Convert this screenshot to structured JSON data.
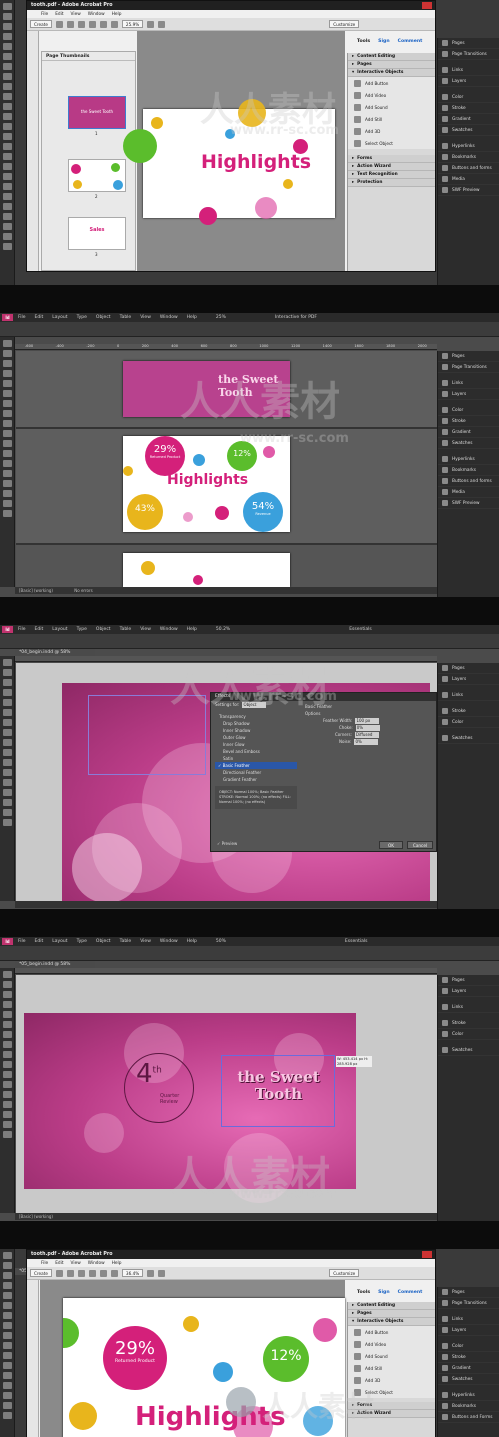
{
  "watermark": {
    "cn": "人人素材",
    "url": "www.rr-sc.com"
  },
  "frame1": {
    "title": "tooth.pdf - Adobe Acrobat Pro",
    "menu": [
      "File",
      "Edit",
      "View",
      "Window",
      "Help"
    ],
    "create_label": "Create",
    "zoom": "25.9%",
    "customize": "Customize",
    "tabs": {
      "tools": "Tools",
      "sign": "Sign",
      "comment": "Comment"
    },
    "thumbnails_title": "Page Thumbnails",
    "thumb_labels": [
      "1",
      "2",
      "3"
    ],
    "thumb1_text": "the Sweet Tooth",
    "thumb3_text": "Sales",
    "page_heading": "Highlights",
    "tools_sections": [
      "Content Editing",
      "Pages",
      "Interactive Objects"
    ],
    "tools_items": [
      "Add Button",
      "Add Video",
      "Add Sound",
      "Add Still",
      "Add 3D",
      "Select Object"
    ],
    "tools_sections_after": [
      "Forms",
      "Action Wizard",
      "Text Recognition",
      "Protection"
    ],
    "dock": [
      "Pages",
      "Page Transitions",
      "Links",
      "Layers",
      "Color",
      "Stroke",
      "Gradient",
      "Swatches",
      "Hyperlinks",
      "Bookmarks",
      "Buttons and forms",
      "Media",
      "SWF Preview"
    ]
  },
  "frame2": {
    "menu": [
      "File",
      "Edit",
      "Layout",
      "Type",
      "Object",
      "Table",
      "View",
      "Window",
      "Help"
    ],
    "zoom": "25%",
    "workspace": "Interactive for PDF",
    "ruler": [
      "-600",
      "-400",
      "-200",
      "0",
      "200",
      "400",
      "600",
      "800",
      "1000",
      "1200",
      "1400",
      "1600",
      "1800",
      "2000"
    ],
    "thumb_text": "the Sweet Tooth",
    "page_heading": "Highlights",
    "stats": [
      {
        "value": "29%",
        "label": "Returned Product"
      },
      {
        "value": "12%",
        "label": ""
      },
      {
        "value": "43%",
        "label": ""
      },
      {
        "value": "54%",
        "label": "Revenue"
      }
    ],
    "status": "[Basic] (working)",
    "errors": "No errors",
    "dock": [
      "Pages",
      "Page Transitions",
      "Links",
      "Layers",
      "Color",
      "Stroke",
      "Gradient",
      "Swatches",
      "Hyperlinks",
      "Bookmarks",
      "Buttons and forms",
      "Media",
      "SWF Preview"
    ]
  },
  "frame3": {
    "menu": [
      "File",
      "Edit",
      "Layout",
      "Type",
      "Object",
      "Table",
      "View",
      "Window",
      "Help"
    ],
    "zoom": "50.2%",
    "workspace": "Essentials",
    "doc_tab": "*04_begin.indd @ 58%",
    "dialog_title": "Effects",
    "settings_for_label": "Settings for:",
    "settings_for_value": "Object",
    "transparency": "Transparency",
    "effects": [
      "Drop Shadow",
      "Inner Shadow",
      "Outer Glow",
      "Inner Glow",
      "Bevel and Emboss",
      "Satin",
      "Basic Feather",
      "Directional Feather",
      "Gradient Feather"
    ],
    "summary": "OBJECT: Normal 100%; Basic Feather STROKE: Normal 100%; (no effects) FILL: Normal 100%; (no effects)",
    "preview": "Preview",
    "panel_title": "Basic Feather",
    "options": "Options",
    "feather_width_label": "Feather Width:",
    "feather_width": "100 px",
    "choke_label": "Choke:",
    "choke": "0%",
    "corners_label": "Corners:",
    "corners": "Diffused",
    "noise_label": "Noise:",
    "noise": "0%",
    "ok": "OK",
    "cancel": "Cancel",
    "dock": [
      "Pages",
      "Layers",
      "Links",
      "Stroke",
      "Color",
      "Swatches"
    ]
  },
  "frame4": {
    "menu": [
      "File",
      "Edit",
      "Layout",
      "Type",
      "Object",
      "Table",
      "View",
      "Window",
      "Help"
    ],
    "zoom": "50%",
    "workspace": "Essentials",
    "doc_tab": "*05_begin.indd @ 58%",
    "quarter_num": "4",
    "quarter_sup": "th",
    "quarter_label": "Quarter Review",
    "logo_text": "the Sweet Tooth",
    "readout": "W: 453.414 px H: 285.928 px",
    "status": "[Basic] (working)",
    "dock": [
      "Pages",
      "Layers",
      "Links",
      "Stroke",
      "Color",
      "Swatches"
    ]
  },
  "frame5": {
    "title": "tooth.pdf - Adobe Acrobat Pro",
    "menu": [
      "File",
      "Edit",
      "View",
      "Window",
      "Help"
    ],
    "doc_tab": "*05_begin.ind",
    "create_label": "Create",
    "zoom": "36.4%",
    "customize": "Customize",
    "tabs": {
      "tools": "Tools",
      "sign": "Sign",
      "comment": "Comment"
    },
    "stat_left": {
      "value": "29%",
      "label": "Returned Product"
    },
    "stat_right": "12%",
    "page_heading": "Highlights",
    "tools_sections": [
      "Content Editing",
      "Pages",
      "Interactive Objects"
    ],
    "tools_items": [
      "Add Button",
      "Add Video",
      "Add Sound",
      "Add Still",
      "Add 3D",
      "Select Object"
    ],
    "tools_sections_after": [
      "Forms",
      "Action Wizard"
    ],
    "dock": [
      "Pages",
      "Page Transitions",
      "Links",
      "Layers",
      "Color",
      "Stroke",
      "Gradient",
      "Swatches",
      "Hyperlinks",
      "Bookmarks",
      "Buttons and Forms"
    ]
  },
  "colors": {
    "magenta": "#d4207a",
    "pink": "#e05aa8",
    "green": "#5bbd2c",
    "blue": "#3aa0dc",
    "yellow": "#e8b51c",
    "acrobat_blue": "#1a62c4"
  }
}
